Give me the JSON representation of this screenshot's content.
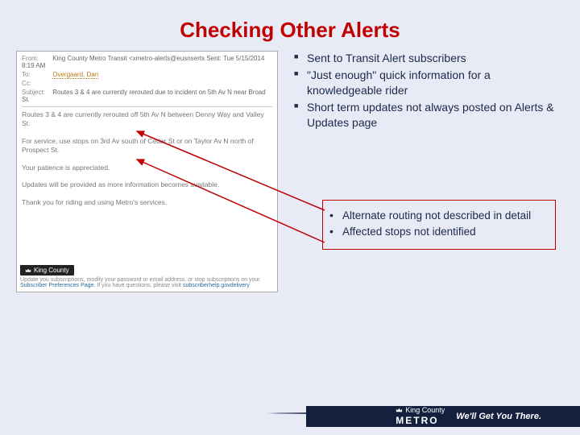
{
  "title": "Checking Other Alerts",
  "email": {
    "from_label": "From:",
    "from_value": "King County Metro Transit <xmetro-alerts@eusnserts   Sent:  Tue 5/15/2014 8:19 AM",
    "to_label": "To:",
    "to_value": "Overgaard, Dan",
    "cc_label": "Cc:",
    "subject_label": "Subject:",
    "subject_value": "Routes 3 & 4 are currently rerouted due to incident on 5th Av N near Broad St.",
    "p1": "Routes 3 & 4 are currently rerouted off 5th Av N between Denny Way and Valley St.",
    "p2": "For service, use stops on 3rd Av south of Cedar St or on Taylor Av N north of Prospect St.",
    "p3": "Your patience is appreciated.",
    "p4": "Updates will be provided as more information becomes available.",
    "p5": "Thank you for riding and using Metro's services.",
    "footer_badge": "King County",
    "footer_text_a": "Update you subscriptions, modify your password or email address, or stop subscriptions on your ",
    "footer_link": "Subscriber Preferences Page",
    "footer_text_b": ". If you have questions, please visit ",
    "footer_link2": "subscriberhelp.govdelivery"
  },
  "main_bullets": [
    "Sent to Transit Alert subscribers",
    "\"Just enough\" quick information for a knowledgeable rider",
    "Short term updates not always posted on Alerts & Updates page"
  ],
  "sub_bullets": [
    "Alternate routing not described in detail",
    "Affected stops not identified"
  ],
  "footer": {
    "kc": "King County",
    "metro": "METRO",
    "tagline": "We'll Get You There."
  },
  "page_number": "14"
}
